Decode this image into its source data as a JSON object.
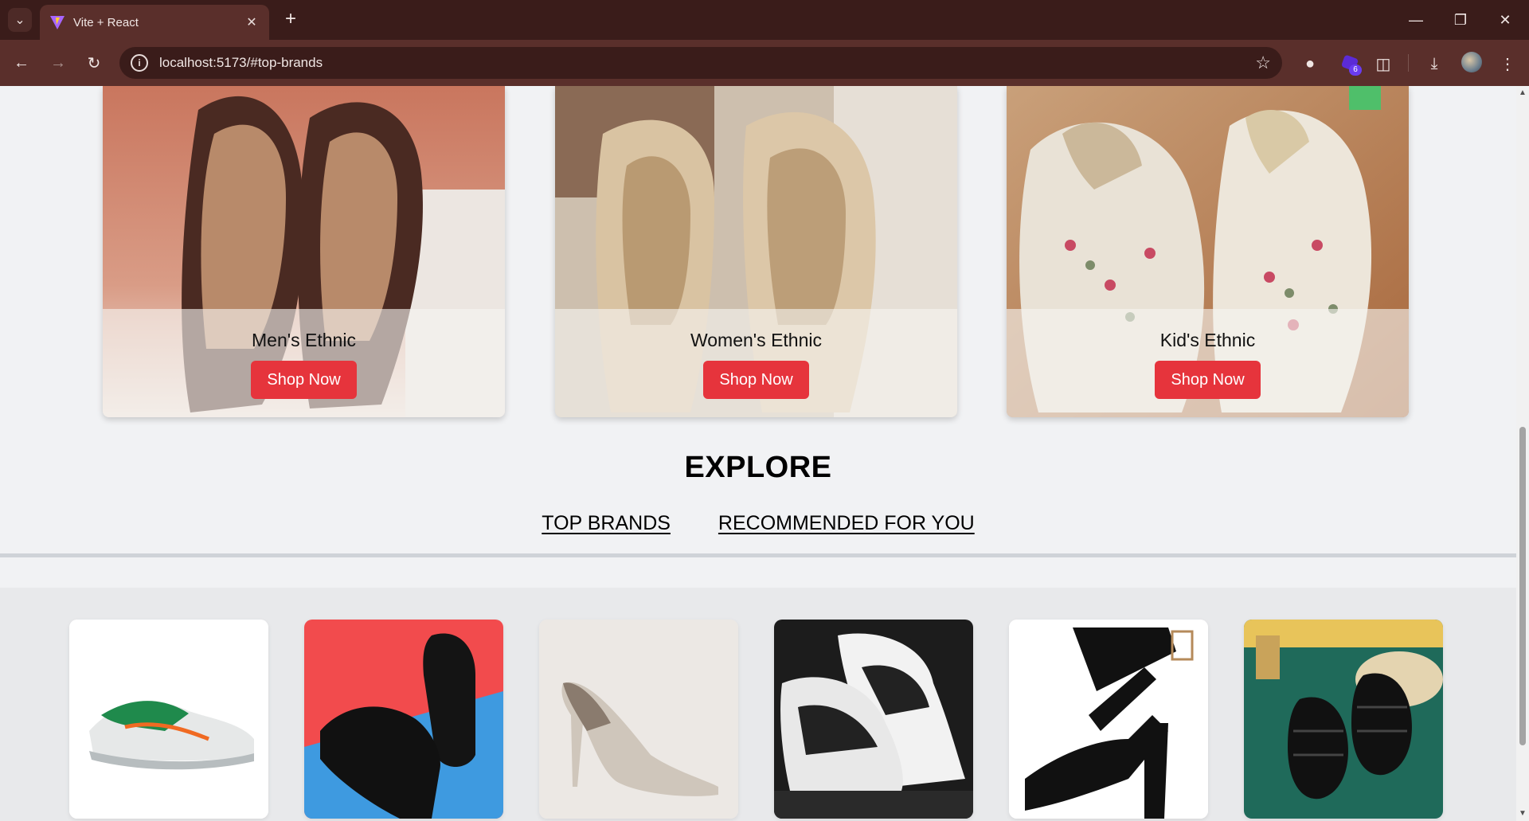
{
  "browser": {
    "tab_title": "Vite + React",
    "url": "localhost:5173/#top-brands",
    "extension_badge_count": "6"
  },
  "ethnic": {
    "cards": [
      {
        "name": "Men's Ethnic",
        "button": "Shop Now"
      },
      {
        "name": "Women's Ethnic",
        "button": "Shop Now"
      },
      {
        "name": "Kid's Ethnic",
        "button": "Shop Now"
      }
    ]
  },
  "explore": {
    "title": "EXPLORE",
    "tabs": [
      "TOP BRANDS",
      "RECOMMENDED FOR YOU"
    ]
  },
  "brands": {
    "items": [
      {
        "icon": "green-sneaker"
      },
      {
        "icon": "black-sneakers"
      },
      {
        "icon": "grey-pump-heel"
      },
      {
        "icon": "black-white-sneakers"
      },
      {
        "icon": "black-strappy-heel"
      },
      {
        "icon": "black-fisherman-sandals"
      }
    ]
  },
  "colors": {
    "accent_button": "#e6343c",
    "chrome_dark": "#3a1c1a",
    "chrome_toolbar": "#5a2f2b"
  }
}
